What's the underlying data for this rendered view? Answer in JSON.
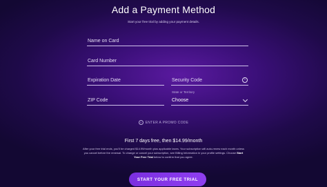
{
  "header": {
    "title": "Add a Payment Method",
    "subtitle": "Start your free trial by adding your payment details."
  },
  "form": {
    "name_on_card": {
      "label": "Name on Card"
    },
    "card_number": {
      "label": "Card Number"
    },
    "expiration_date": {
      "label": "Expiration Date"
    },
    "security_code": {
      "label": "Security Code",
      "icon": "info-icon"
    },
    "zip_code": {
      "label": "ZIP Code"
    },
    "state": {
      "label": "State or Territory",
      "value": "Choose",
      "icon": "chevron-down-icon"
    }
  },
  "promo": {
    "label": "ENTER A PROMO CODE",
    "icon": "plus-circle-icon"
  },
  "pricing": {
    "headline": "First 7 days free, then $14.99/month"
  },
  "legal": {
    "text_1": "After your free trial ends, you'll be charged $14.99/month plus applicable taxes. Your subscription will auto-renew each month unless you cancel before the renewal. To change or cancel your subscription, see Billing Information in your profile settings. Choose ",
    "cta_ref": "Start Your Free Trial",
    "text_2": " below to confirm that you agree."
  },
  "cta": {
    "label": "START YOUR FREE TRIAL"
  },
  "colors": {
    "background": "#3a0f78",
    "accent": "#8f3ef0"
  }
}
